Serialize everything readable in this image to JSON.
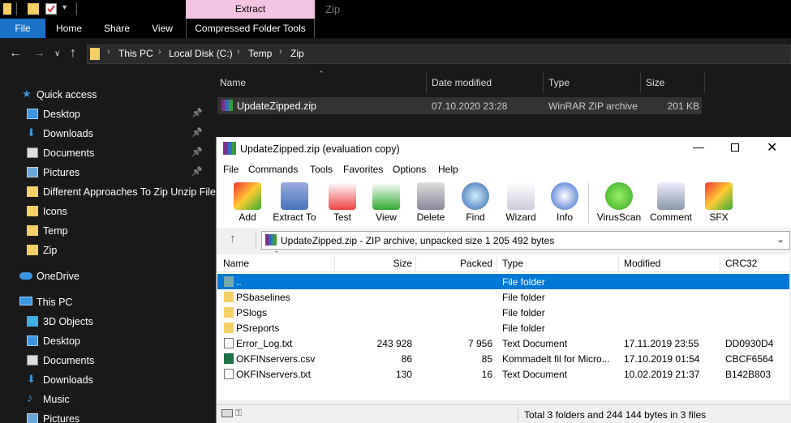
{
  "explorer": {
    "context_tab": "Extract",
    "window_title": "Zip",
    "tabs": [
      "File",
      "Home",
      "Share",
      "View",
      "Compressed Folder Tools"
    ],
    "breadcrumb": [
      "This PC",
      "Local Disk (C:)",
      "Temp",
      "Zip"
    ],
    "columns": [
      "Name",
      "Date modified",
      "Type",
      "Size"
    ],
    "file": {
      "name": "UpdateZipped.zip",
      "date": "07.10.2020 23:28",
      "type": "WinRAR ZIP archive",
      "size": "201 KB"
    },
    "sidebar": {
      "quick_access": "Quick access",
      "quick_items": [
        {
          "label": "Desktop",
          "icon": "desktop-icon",
          "pinned": true
        },
        {
          "label": "Downloads",
          "icon": "download-icon",
          "pinned": true
        },
        {
          "label": "Documents",
          "icon": "documents-icon",
          "pinned": true
        },
        {
          "label": "Pictures",
          "icon": "pictures-icon",
          "pinned": true
        },
        {
          "label": "Different Approaches To Zip Unzip File",
          "icon": "folder-icon",
          "pinned": false
        },
        {
          "label": "Icons",
          "icon": "folder-icon",
          "pinned": false
        },
        {
          "label": "Temp",
          "icon": "folder-icon",
          "pinned": false
        },
        {
          "label": "Zip",
          "icon": "folder-icon",
          "pinned": false
        }
      ],
      "onedrive": "OneDrive",
      "this_pc": "This PC",
      "pc_items": [
        {
          "label": "3D Objects",
          "icon": "3d-objects-icon"
        },
        {
          "label": "Desktop",
          "icon": "desktop-icon"
        },
        {
          "label": "Documents",
          "icon": "documents-icon"
        },
        {
          "label": "Downloads",
          "icon": "download-icon"
        },
        {
          "label": "Music",
          "icon": "music-icon"
        },
        {
          "label": "Pictures",
          "icon": "pictures-icon"
        }
      ]
    }
  },
  "winrar": {
    "title": "UpdateZipped.zip (evaluation copy)",
    "menu": [
      "File",
      "Commands",
      "Tools",
      "Favorites",
      "Options",
      "Help"
    ],
    "toolbar": [
      "Add",
      "Extract To",
      "Test",
      "View",
      "Delete",
      "Find",
      "Wizard",
      "Info",
      "VirusScan",
      "Comment",
      "SFX"
    ],
    "path_text": "UpdateZipped.zip - ZIP archive, unpacked size 1 205 492 bytes",
    "columns": [
      "Name",
      "Size",
      "Packed",
      "Type",
      "Modified",
      "CRC32"
    ],
    "rows": [
      {
        "name": "..",
        "size": "",
        "packed": "",
        "type": "File folder",
        "modified": "",
        "crc": "",
        "icon": "folder-up-icon",
        "selected": true
      },
      {
        "name": "PSbaselines",
        "size": "",
        "packed": "",
        "type": "File folder",
        "modified": "",
        "crc": "",
        "icon": "folder-icon",
        "selected": false
      },
      {
        "name": "PSlogs",
        "size": "",
        "packed": "",
        "type": "File folder",
        "modified": "",
        "crc": "",
        "icon": "folder-icon",
        "selected": false
      },
      {
        "name": "PSreports",
        "size": "",
        "packed": "",
        "type": "File folder",
        "modified": "",
        "crc": "",
        "icon": "folder-icon",
        "selected": false
      },
      {
        "name": "Error_Log.txt",
        "size": "243 928",
        "packed": "7 956",
        "type": "Text Document",
        "modified": "17.11.2019 23:55",
        "crc": "DD0930D4",
        "icon": "text-file-icon",
        "selected": false
      },
      {
        "name": "OKFINservers.csv",
        "size": "86",
        "packed": "85",
        "type": "Kommadelt fil for Micro...",
        "modified": "17.10.2019 01:54",
        "crc": "CBCF6564",
        "icon": "excel-file-icon",
        "selected": false
      },
      {
        "name": "OKFINservers.txt",
        "size": "130",
        "packed": "16",
        "type": "Text Document",
        "modified": "10.02.2019 21:37",
        "crc": "B142B803",
        "icon": "text-file-icon",
        "selected": false
      }
    ],
    "status": "Total 3 folders and 244 144 bytes in 3 files"
  }
}
